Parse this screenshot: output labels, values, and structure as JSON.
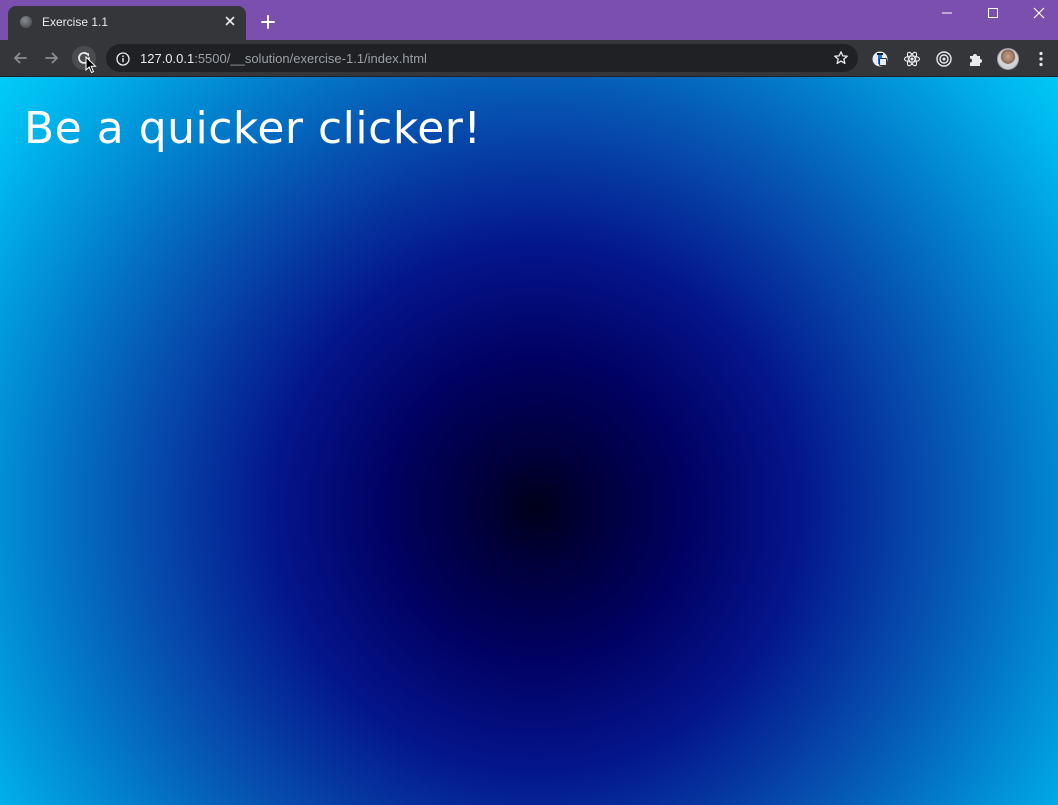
{
  "browser": {
    "tab": {
      "title": "Exercise 1.1"
    },
    "address_bar": {
      "host": "127.0.0.1",
      "path": ":5500/__solution/exercise-1.1/index.html"
    },
    "colors": {
      "tabstrip": "#7b4fad",
      "toolbar": "#35363a",
      "omnibox": "#202124"
    },
    "icons": {
      "favicon": "globe-icon",
      "tab_close": "close-icon",
      "new_tab": "plus-icon",
      "back": "arrow-left-icon",
      "forward": "arrow-right-icon",
      "reload": "reload-icon",
      "site_info": "info-icon",
      "bookmark": "star-icon",
      "extensions": [
        "lighthouse-icon",
        "react-devtools-icon",
        "target-icon",
        "puzzle-icon"
      ],
      "profile": "avatar",
      "menu": "kebab-menu-icon"
    }
  },
  "page": {
    "heading": "Be a quicker clicker!",
    "colors": {
      "heading": "#ffffff",
      "gradient_center": "#00001a",
      "gradient_mid": "#010163",
      "gradient_edge": "#00ccf8"
    }
  }
}
